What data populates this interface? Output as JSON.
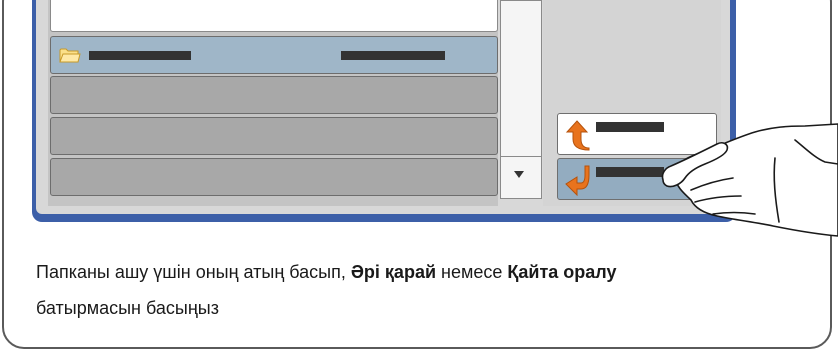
{
  "instruction": {
    "part1": "Папканы ашу үшін  оның атың басып, ",
    "forward_label": "Әрі қарай",
    "part2": " немесе ",
    "back_label": "Қайта оралу",
    "part3": " батырмасын басыңыз"
  },
  "list": {
    "selected_row_icon": "folder-icon"
  },
  "colors": {
    "device_frame": "#3c5fa8",
    "selected_row": "#9fb6c8",
    "row": "#a8a8a8",
    "back_button": "#93acc0",
    "arrow": "#e8731d"
  }
}
